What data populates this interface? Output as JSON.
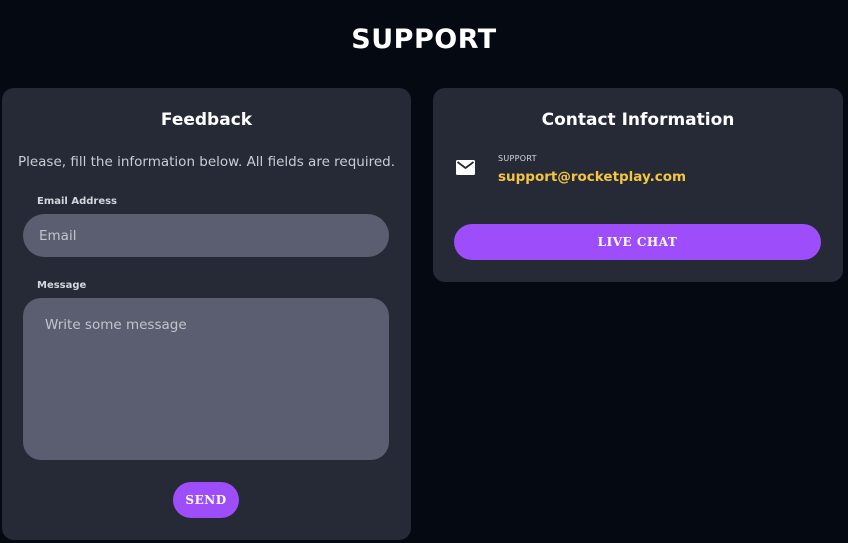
{
  "page": {
    "title": "SUPPORT"
  },
  "feedback": {
    "title": "Feedback",
    "intro": "Please, fill the information below. All fields are required.",
    "email_label": "Email Address",
    "email_placeholder": "Email",
    "email_value": "",
    "message_label": "Message",
    "message_placeholder": "Write some message",
    "message_value": "",
    "send_label": "SEND"
  },
  "contact": {
    "title": "Contact Information",
    "support_label": "SUPPORT",
    "support_email": "support@rocketplay.com",
    "live_chat_label": "LIVE CHAT"
  },
  "icons": {
    "mail": "mail-icon"
  },
  "colors": {
    "background": "#040912",
    "card": "#262a36",
    "input": "#5b5d71",
    "accent": "#9d4dfa",
    "email_link": "#f4c542"
  }
}
